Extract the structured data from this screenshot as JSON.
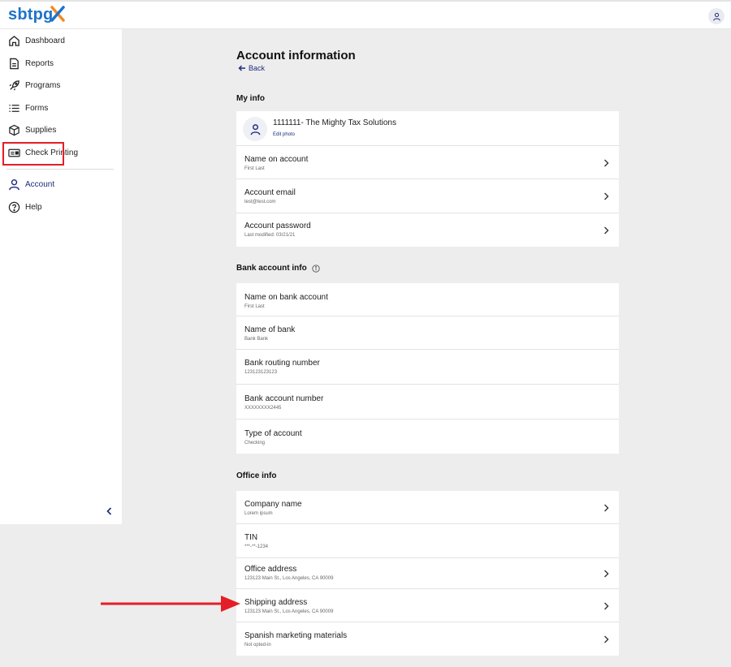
{
  "brand": {
    "logo_text": "sbtpg",
    "logo_x_colors": [
      "#f08a24",
      "#1e73c9"
    ]
  },
  "header": {
    "user_icon": "user-icon"
  },
  "sidebar": {
    "items": [
      {
        "label": "Dashboard",
        "icon": "home-icon"
      },
      {
        "label": "Reports",
        "icon": "document-icon"
      },
      {
        "label": "Programs",
        "icon": "rocket-icon"
      },
      {
        "label": "Forms",
        "icon": "list-icon"
      },
      {
        "label": "Supplies",
        "icon": "box-icon"
      },
      {
        "label": "Check Printing",
        "icon": "check-icon"
      },
      {
        "label": "Account",
        "icon": "user-icon",
        "active": true
      },
      {
        "label": "Help",
        "icon": "help-icon"
      }
    ],
    "collapse_icon": "chevron-left-icon"
  },
  "page": {
    "title": "Account information",
    "back_label": "Back"
  },
  "my_info": {
    "title": "My info",
    "org_name": "1111111- The Mighty Tax Solutions",
    "edit_photo": "Edit photo",
    "rows": [
      {
        "label": "Name on account",
        "value": "First Last"
      },
      {
        "label": "Account email",
        "value": "test@test.com"
      },
      {
        "label": "Account password",
        "value": "Last modified: 03/21/21"
      }
    ]
  },
  "bank_info": {
    "title": "Bank account info",
    "rows": [
      {
        "label": "Name on bank account",
        "value": "First Last"
      },
      {
        "label": "Name of bank",
        "value": "Bank Bank"
      },
      {
        "label": "Bank routing number",
        "value": "123123123123"
      },
      {
        "label": "Bank account number",
        "value": "XXXXXXXX2445"
      },
      {
        "label": "Type of account",
        "value": "Checking"
      }
    ]
  },
  "office_info": {
    "title": "Office info",
    "rows": [
      {
        "label": "Company name",
        "value": "Lorem ipsum"
      },
      {
        "label": "TIN",
        "value": "***-**-1234"
      },
      {
        "label": "Office address",
        "value": "123123 Main St., Los Angeles, CA 90009"
      },
      {
        "label": "Shipping address",
        "value": "123123 Main St., Los Angeles, CA 90009"
      },
      {
        "label": "Spanish marketing materials",
        "value": "Not opted-in"
      }
    ]
  },
  "colors": {
    "accent": "#1d2d7a",
    "highlight": "#e41e26",
    "logo": "#1e73c9"
  }
}
